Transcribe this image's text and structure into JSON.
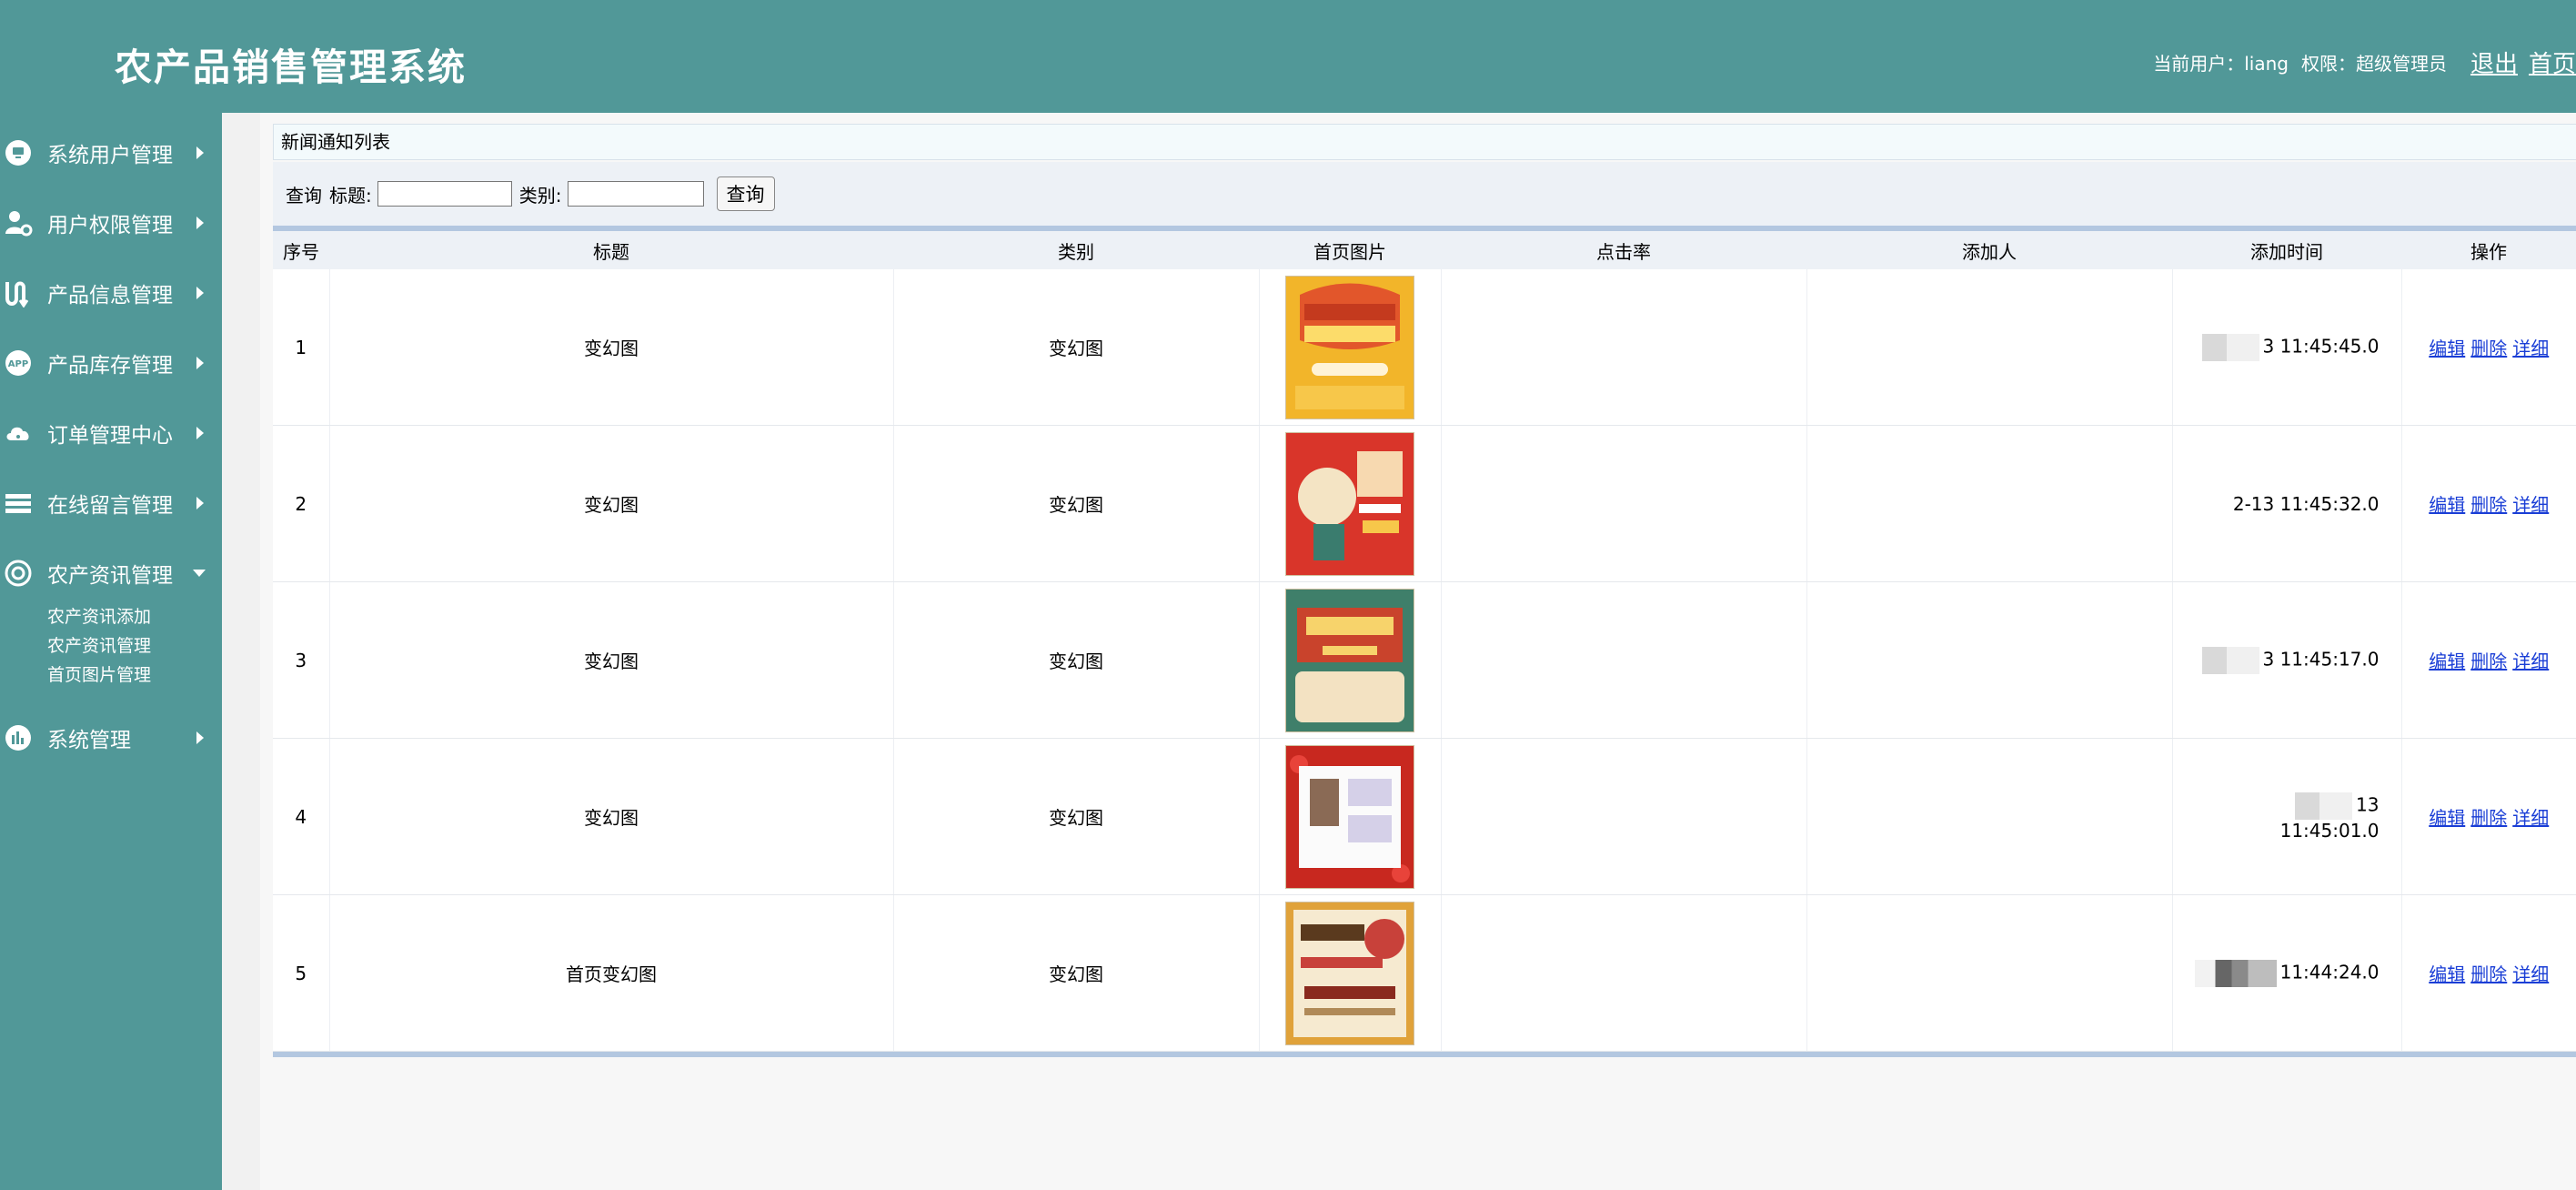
{
  "header": {
    "title": "农产品销售管理系统",
    "current_user_label": "当前用户：liang",
    "role_label": "权限：超级管理员",
    "logout": "退出",
    "home": "首页"
  },
  "sidebar": {
    "items": [
      {
        "label": "系统用户管理",
        "icon": "monitor-icon"
      },
      {
        "label": "用户权限管理",
        "icon": "user-gear-icon"
      },
      {
        "label": "产品信息管理",
        "icon": "route-icon"
      },
      {
        "label": "产品库存管理",
        "icon": "app-icon"
      },
      {
        "label": "订单管理中心",
        "icon": "cloud-icon"
      },
      {
        "label": "在线留言管理",
        "icon": "layers-icon"
      },
      {
        "label": "农产资讯管理",
        "icon": "settings-icon"
      },
      {
        "label": "系统管理",
        "icon": "bar-chart-icon"
      }
    ],
    "submenu": [
      "农产资讯添加",
      "农产资讯管理",
      "首页图片管理"
    ]
  },
  "panel": {
    "title": "新闻通知列表"
  },
  "search": {
    "query_label": "查询",
    "title_label": "标题:",
    "category_label": "类别:",
    "button": "查询"
  },
  "table": {
    "headers": [
      "序号",
      "标题",
      "类别",
      "首页图片",
      "点击率",
      "添加人",
      "添加时间",
      "操作"
    ],
    "rows": [
      {
        "no": "1",
        "title": "变幻图",
        "category": "变幻图",
        "clicks": "",
        "adder": "",
        "time": "3 11:45:45.0",
        "image": "banner-orange"
      },
      {
        "no": "2",
        "title": "变幻图",
        "category": "变幻图",
        "clicks": "",
        "adder": "",
        "time": "2-13 11:45:32.0",
        "image": "banner-red"
      },
      {
        "no": "3",
        "title": "变幻图",
        "category": "变幻图",
        "clicks": "",
        "adder": "",
        "time": "3 11:45:17.0",
        "image": "banner-green"
      },
      {
        "no": "4",
        "title": "变幻图",
        "category": "变幻图",
        "clicks": "",
        "adder": "",
        "time": "13 11:45:01.0",
        "image": "banner-strawberry"
      },
      {
        "no": "5",
        "title": "首页变幻图",
        "category": "变幻图",
        "clicks": "",
        "adder": "",
        "time": "11:44:24.0",
        "image": "banner-festival"
      }
    ],
    "ops": {
      "edit": "编辑",
      "delete": "删除",
      "detail": "详细"
    }
  },
  "colors": {
    "brand": "#519898",
    "link": "#1a3ed6",
    "header_bg": "#edf1f6",
    "table_line": "#b3c7e0"
  }
}
